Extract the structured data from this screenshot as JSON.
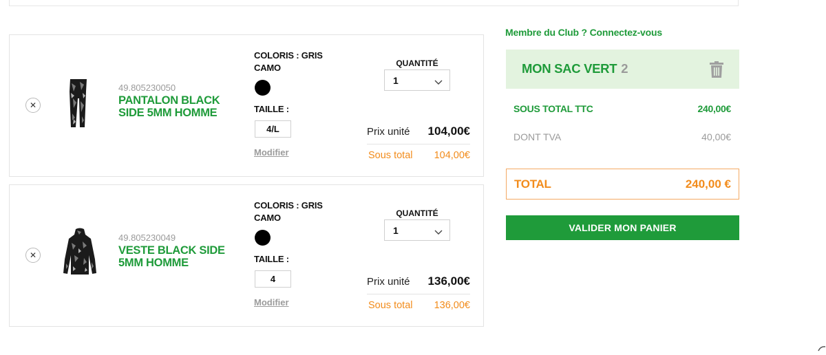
{
  "cart": {
    "items": [
      {
        "remove_icon": "close-icon",
        "image": "wetsuit-pants-image",
        "ref": "49.805230050",
        "name": "PANTALON BLACK SIDE 5MM HOMME",
        "color_label": "COLORIS : GRIS CAMO",
        "color_hex": "#000000",
        "size_label": "TAILLE :",
        "size_value": "4/L",
        "modify_label": "Modifier",
        "qty_label": "QUANTITÉ",
        "qty_value": "1",
        "unit_price_label": "Prix unité",
        "unit_price": "104,00€",
        "subtotal_label": "Sous total",
        "subtotal": "104,00€"
      },
      {
        "remove_icon": "close-icon",
        "image": "wetsuit-jacket-image",
        "ref": "49.805230049",
        "name": "VESTE BLACK SIDE 5MM HOMME",
        "color_label": "COLORIS : GRIS CAMO",
        "color_hex": "#000000",
        "size_label": "TAILLE :",
        "size_value": "4",
        "modify_label": "Modifier",
        "qty_label": "QUANTITÉ",
        "qty_value": "1",
        "unit_price_label": "Prix unité",
        "unit_price": "136,00€",
        "subtotal_label": "Sous total",
        "subtotal": "136,00€"
      }
    ]
  },
  "summary": {
    "member_link": "Membre du Club ? Connectez-vous",
    "bag_title": "MON SAC VERT",
    "bag_count": "2",
    "trash_icon": "trash-icon",
    "subtotal_label": "SOUS TOTAL TTC",
    "subtotal_value": "240,00€",
    "tax_label": "DONT TVA",
    "tax_value": "40,00€",
    "total_label": "TOTAL",
    "total_value": "240,00 €",
    "validate_label": "VALIDER MON PANIER"
  },
  "colors": {
    "brand_green": "#1f9b3a",
    "accent_orange": "#f28c1c",
    "bag_header_bg": "#e3f3df"
  }
}
